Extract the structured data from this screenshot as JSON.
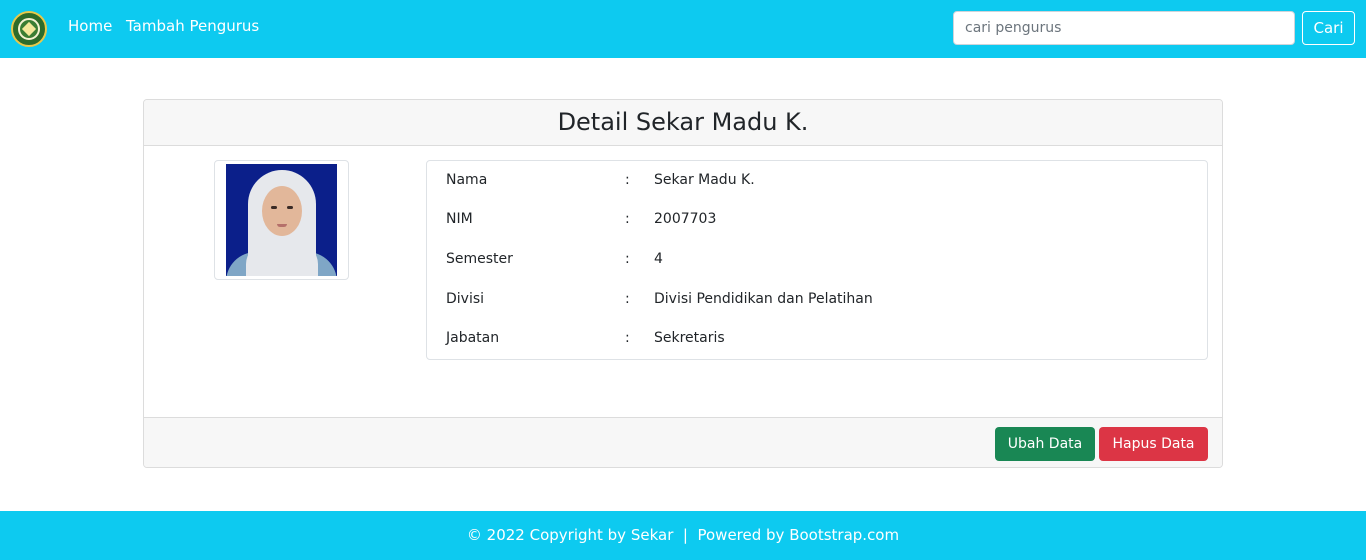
{
  "navbar": {
    "logo_icon": "organization-seal-icon",
    "links": [
      "Home",
      "Tambah Pengurus"
    ],
    "search_placeholder": "cari pengurus",
    "search_button": "Cari",
    "background": "#0dcaf0"
  },
  "card": {
    "title": "Detail Sekar Madu K.",
    "photo_icon": "profile-photo",
    "fields": [
      {
        "label": "Nama",
        "colon": ":",
        "value": "Sekar Madu K."
      },
      {
        "label": "NIM",
        "colon": ":",
        "value": "2007703"
      },
      {
        "label": "Semester",
        "colon": ":",
        "value": "4"
      },
      {
        "label": "Divisi",
        "colon": ":",
        "value": "Divisi Pendidikan dan Pelatihan"
      },
      {
        "label": "Jabatan",
        "colon": ":",
        "value": "Sekretaris"
      }
    ],
    "edit_button": "Ubah Data",
    "delete_button": "Hapus Data",
    "edit_color": "#198754",
    "delete_color": "#dc3545"
  },
  "footer": {
    "text": "© 2022 Copyright by Sekar  |  Powered by Bootstrap.com"
  }
}
